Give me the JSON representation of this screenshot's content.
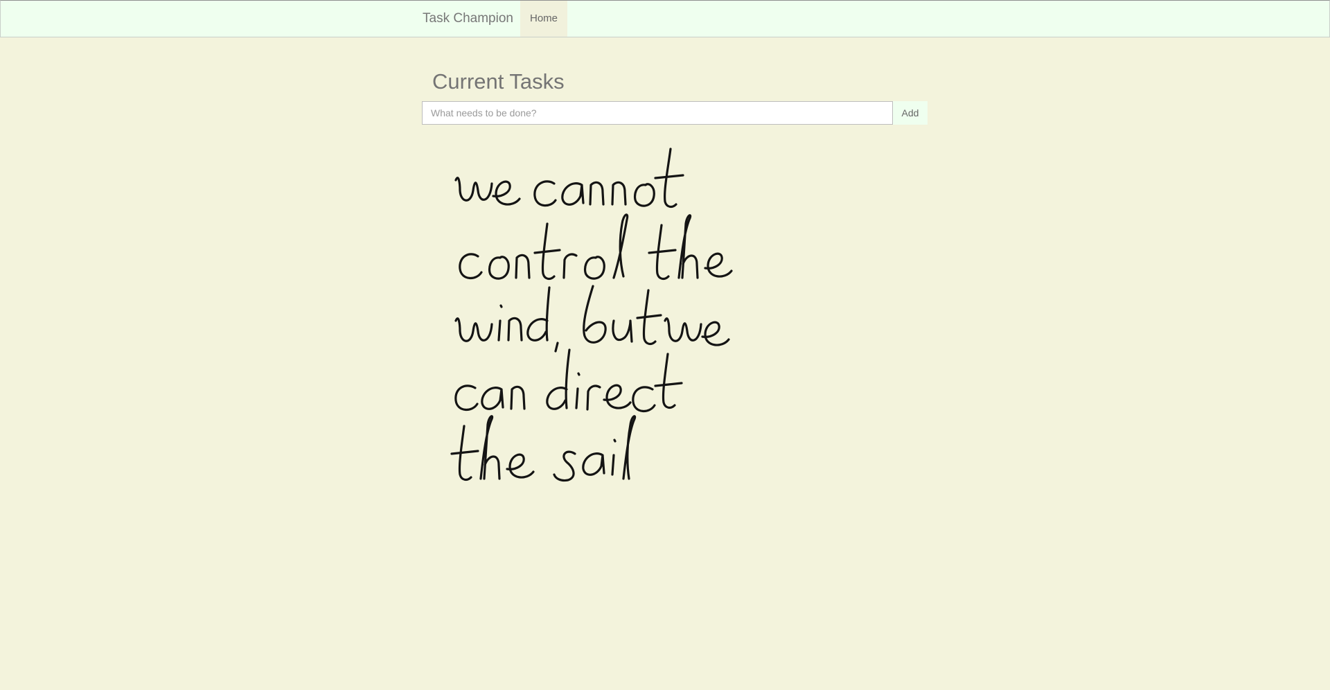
{
  "navbar": {
    "brand": "Task Champion",
    "home_label": "Home"
  },
  "main": {
    "title": "Current Tasks",
    "input_placeholder": "What needs to be done?",
    "input_value": "",
    "add_label": "Add"
  },
  "handwritten_note": {
    "lines": [
      "we cannot",
      "control the",
      "wind, but we",
      "can direct",
      "the sail"
    ]
  }
}
